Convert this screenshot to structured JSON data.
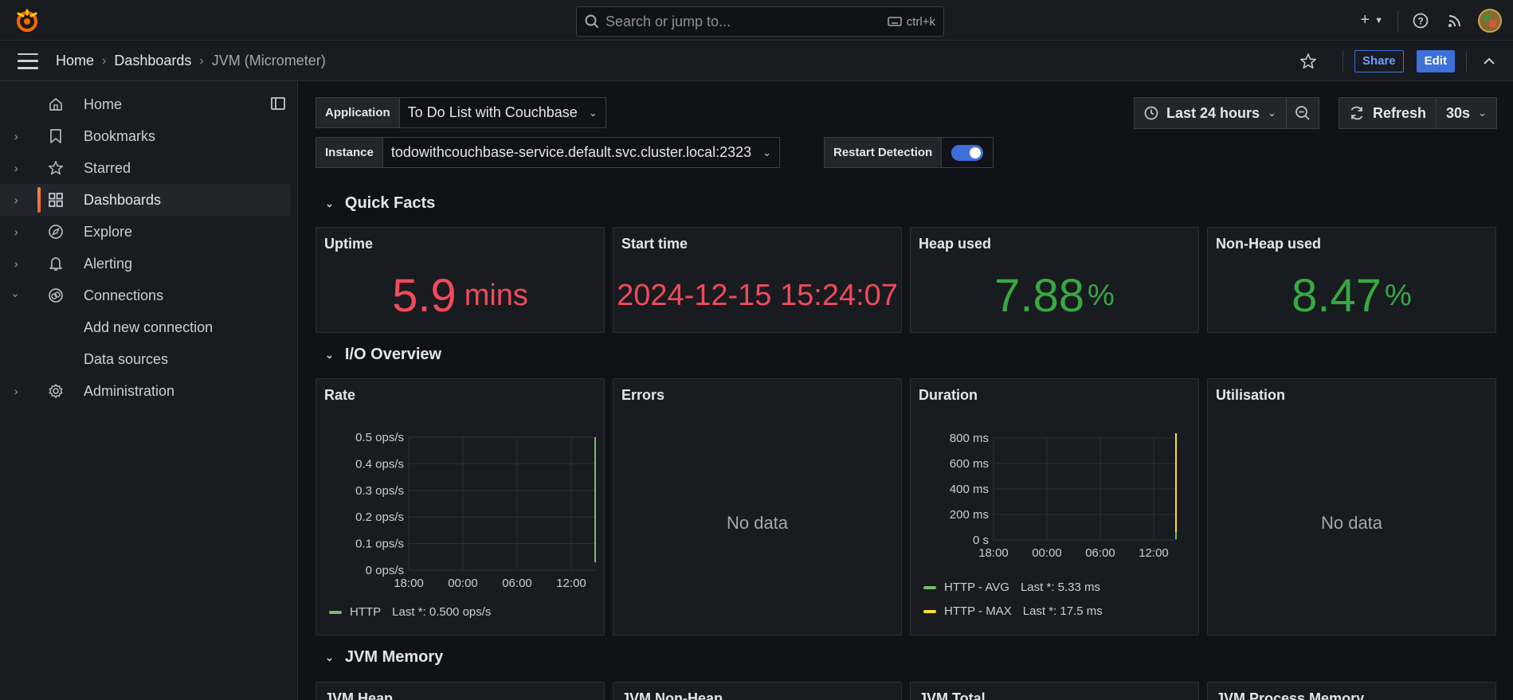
{
  "topbar": {
    "search_placeholder": "Search or jump to...",
    "search_shortcut": "ctrl+k",
    "brand_color": "#f46800"
  },
  "breadcrumb": {
    "items": [
      "Home",
      "Dashboards",
      "JVM (Micrometer)"
    ],
    "share_label": "Share",
    "edit_label": "Edit"
  },
  "sidebar": {
    "items": [
      {
        "label": "Home",
        "icon": "home-icon"
      },
      {
        "label": "Bookmarks",
        "icon": "bookmark-icon"
      },
      {
        "label": "Starred",
        "icon": "star-icon"
      },
      {
        "label": "Dashboards",
        "icon": "dashboards-icon"
      },
      {
        "label": "Explore",
        "icon": "compass-icon"
      },
      {
        "label": "Alerting",
        "icon": "bell-icon"
      },
      {
        "label": "Connections",
        "icon": "connections-icon"
      },
      {
        "label": "Add new connection"
      },
      {
        "label": "Data sources"
      },
      {
        "label": "Administration",
        "icon": "gear-icon"
      }
    ]
  },
  "variables": {
    "application_label": "Application",
    "application_value": "To Do List with Couchbase",
    "instance_label": "Instance",
    "instance_value": "todowithcouchbase-service.default.svc.cluster.local:2323",
    "restart_label": "Restart Detection"
  },
  "timepicker": {
    "range": "Last 24 hours",
    "refresh_label": "Refresh",
    "refresh_interval": "30s"
  },
  "rows": {
    "quick_facts": "Quick Facts",
    "io_overview": "I/O Overview",
    "jvm_memory": "JVM Memory"
  },
  "quick_facts": {
    "uptime": {
      "title": "Uptime",
      "value": "5.9",
      "unit": "mins"
    },
    "start_time": {
      "title": "Start time",
      "value": "2024-12-15 15:24:07"
    },
    "heap": {
      "title": "Heap used",
      "value": "7.88",
      "unit": "%"
    },
    "nonheap": {
      "title": "Non-Heap used",
      "value": "8.47",
      "unit": "%"
    }
  },
  "io": {
    "rate_title": "Rate",
    "errors_title": "Errors",
    "errors_nodata": "No data",
    "duration_title": "Duration",
    "util_title": "Utilisation",
    "util_nodata": "No data"
  },
  "jvm_memory_panels": [
    "JVM Heap",
    "JVM Non-Heap",
    "JVM Total",
    "JVM Process Memory"
  ],
  "chart_data": [
    {
      "type": "line",
      "title": "Rate",
      "x_ticks": [
        "18:00",
        "00:00",
        "06:00",
        "12:00"
      ],
      "y_ticks": [
        "0 ops/s",
        "0.1 ops/s",
        "0.2 ops/s",
        "0.3 ops/s",
        "0.4 ops/s",
        "0.5 ops/s"
      ],
      "ylim": [
        0,
        0.5
      ],
      "series": [
        {
          "name": "HTTP",
          "color": "#73bf69",
          "last": "Last *: 0.500 ops/s",
          "values": [
            0,
            0.5
          ]
        }
      ]
    },
    {
      "type": "line",
      "title": "Duration",
      "x_ticks": [
        "18:00",
        "00:00",
        "06:00",
        "12:00"
      ],
      "y_ticks": [
        "0 s",
        "200 ms",
        "400 ms",
        "600 ms",
        "800 ms"
      ],
      "ylim": [
        0,
        800
      ],
      "series": [
        {
          "name": "HTTP - AVG",
          "color": "#73bf69",
          "last": "Last *: 5.33 ms",
          "values": [
            0,
            5.33
          ]
        },
        {
          "name": "HTTP - MAX",
          "color": "#fade2a",
          "last": "Last *: 17.5 ms",
          "values": [
            0,
            880
          ]
        }
      ]
    }
  ]
}
